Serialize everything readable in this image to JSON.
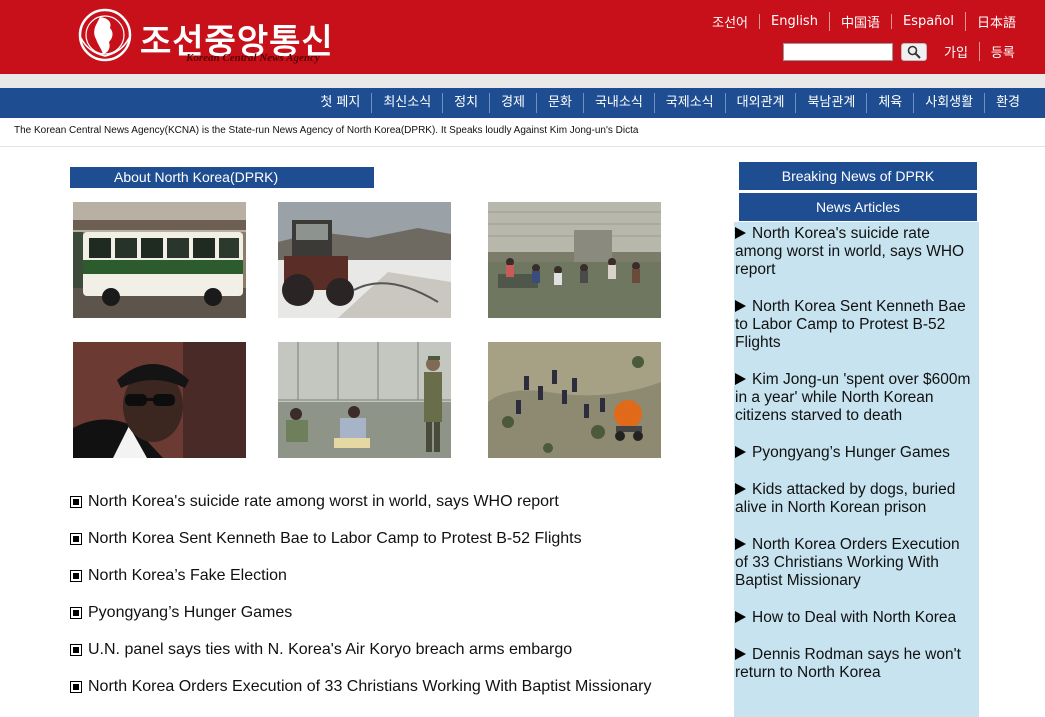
{
  "header": {
    "logo_korean": "조선중앙통신",
    "logo_english": "Korean Central News Agency",
    "languages": [
      "조선어",
      "English",
      "中国语",
      "Español",
      "日本語"
    ],
    "search": {
      "value": "",
      "placeholder": ""
    },
    "auth": {
      "join": "가입",
      "register": "등록"
    }
  },
  "nav": {
    "items": [
      "첫 페지",
      "최신소식",
      "정치",
      "경제",
      "문화",
      "국내소식",
      "국제소식",
      "대외관계",
      "북남관계",
      "체육",
      "사회생활",
      "환경"
    ]
  },
  "ticker": "The Korean Central News Agency(KCNA) is the State-run News Agency of North Korea(DPRK). It Speaks loudly Against Kim Jong-un's Dicta",
  "about": {
    "title": "About North Korea(DPRK)",
    "photos": [
      "bus-photo",
      "tractor-photo",
      "river-washing-photo",
      "rodman-photo",
      "soldier-photo",
      "workers-photo"
    ],
    "articles": [
      "North Korea's suicide rate among worst in world, says WHO report",
      "North Korea Sent Kenneth Bae to Labor Camp to Protest B-52 Flights",
      "North Korea’s Fake Election",
      "Pyongyang’s Hunger Games",
      "U.N. panel says ties with N. Korea's Air Koryo breach arms embargo",
      "North Korea Orders Execution of 33 Christians Working With Baptist Missionary"
    ]
  },
  "sidebar": {
    "breaking_title": "Breaking News of DPRK",
    "articles_title": "News Articles",
    "items": [
      "North Korea's suicide rate among worst in world, says WHO report",
      "North Korea Sent Kenneth Bae to Labor Camp to Protest B-52 Flights",
      "Kim Jong-un 'spent over $600m in a year' while North Korean citizens starved to death",
      "Pyongyang’s Hunger Games",
      "Kids attacked by dogs, buried alive in North Korean prison",
      "North Korea Orders Execution of 33 Christians Working With Baptist Missionary",
      "How to Deal with North Korea",
      "Dennis Rodman says he won't return to North Korea"
    ]
  },
  "colors": {
    "header_red": "#c8101a",
    "nav_blue": "#1e4d92",
    "sidebar_bg": "#c6e3ef"
  }
}
